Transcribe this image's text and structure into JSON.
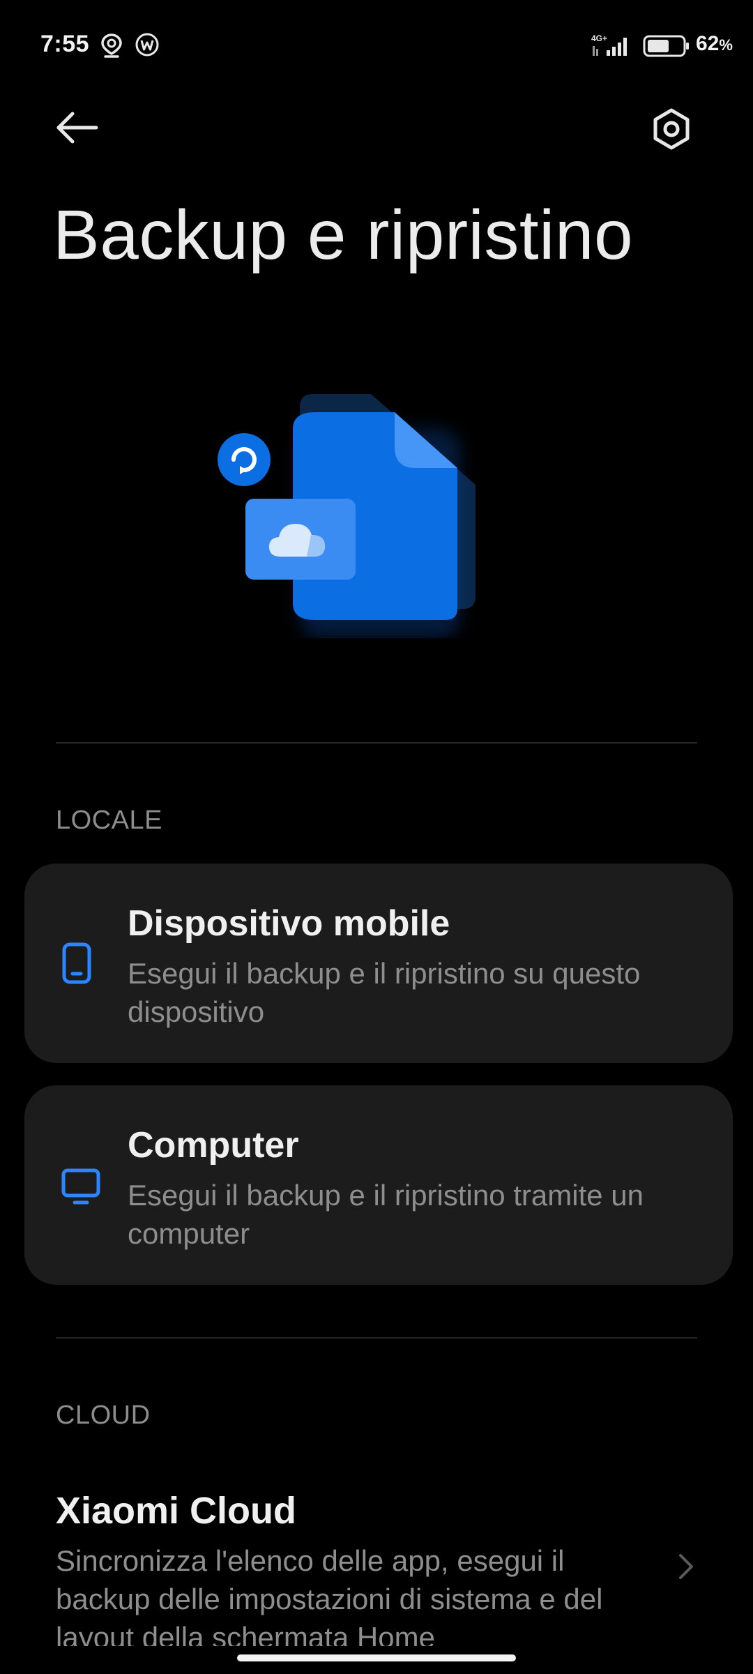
{
  "status_bar": {
    "time": "7:55",
    "battery_percent": "62",
    "battery_unit": "%",
    "battery_level": 0.62,
    "network": "4G+",
    "left_icons": [
      "location-icon",
      "w-app-icon"
    ]
  },
  "header": {
    "title": "Backup e ripristino",
    "back_icon": "arrow-left-icon",
    "settings_icon": "gear-icon"
  },
  "sections": {
    "local": {
      "label": "LOCALE",
      "items": [
        {
          "title": "Dispositivo mobile",
          "subtitle": "Esegui il backup e il ripristino su questo dispositivo",
          "icon": "phone-icon"
        },
        {
          "title": "Computer",
          "subtitle": "Esegui il backup e il ripristino tramite un computer",
          "icon": "monitor-icon"
        }
      ]
    },
    "cloud": {
      "label": "CLOUD",
      "items": [
        {
          "title": "Xiaomi Cloud",
          "subtitle": "Sincronizza l'elenco delle app, esegui il backup delle impostazioni di sistema e del layout della schermata Home",
          "icon": "chevron-right-icon"
        }
      ]
    }
  },
  "colors": {
    "background": "#000000",
    "card": "#1c1c1c",
    "accent": "#1a73e8",
    "secondary_text": "#8e8e8e"
  }
}
